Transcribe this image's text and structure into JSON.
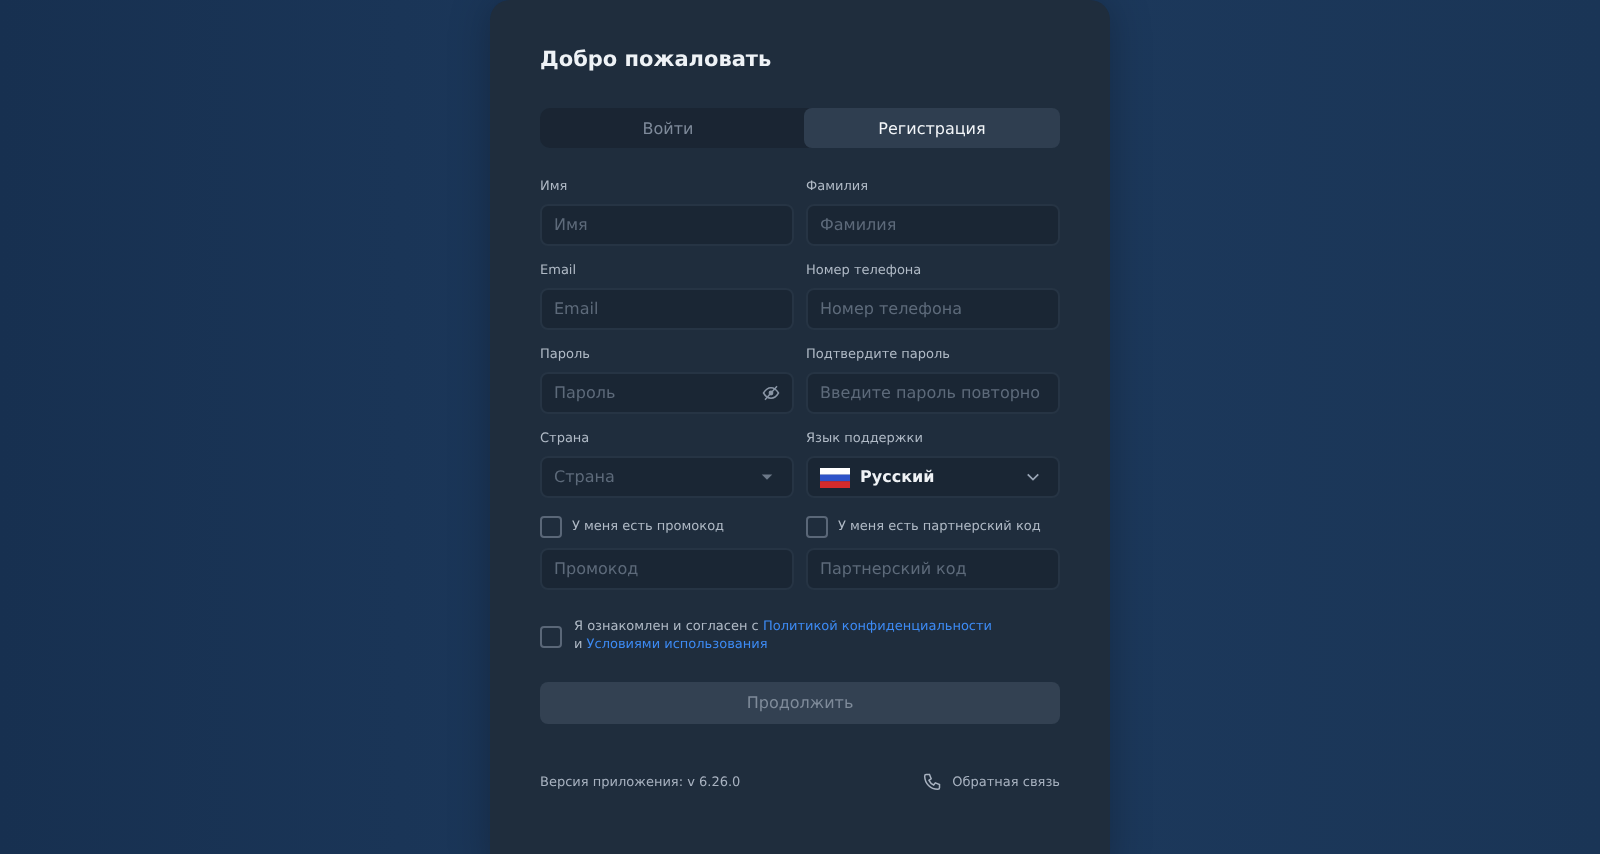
{
  "title": "Добро пожаловать",
  "tabs": [
    {
      "label": "Войти",
      "selected": false
    },
    {
      "label": "Регистрация",
      "selected": true
    }
  ],
  "fields": [
    {
      "kind": "text",
      "label": "Имя",
      "placeholder": "Имя"
    },
    {
      "kind": "text",
      "label": "Фамилия",
      "placeholder": "Фамилия"
    },
    {
      "kind": "text",
      "label": "Email",
      "placeholder": "Email"
    },
    {
      "kind": "text",
      "label": "Номер телефона",
      "placeholder": "Номер телефона"
    },
    {
      "kind": "password",
      "label": "Пароль",
      "placeholder": "Пароль"
    },
    {
      "kind": "text",
      "label": "Подтвердите пароль",
      "placeholder": "Введите пароль повторно"
    },
    {
      "kind": "select",
      "label": "Страна",
      "placeholder": "Страна"
    },
    {
      "kind": "language",
      "label": "Язык поддержки",
      "value": "Русский"
    }
  ],
  "codes": [
    {
      "label": "У меня есть промокод",
      "checked": false,
      "placeholder": "Промокод"
    },
    {
      "label": "У меня есть партнерский код",
      "checked": false,
      "placeholder": "Партнерский код"
    }
  ],
  "agreement": {
    "checked": false,
    "text": "Я ознакомлен и согласен с",
    "link_1": "Политикой конфиденциальности",
    "joiner": "и",
    "link_2": "Условиями использования"
  },
  "submit": {
    "label": "Продолжить",
    "disabled": true
  },
  "version": "Версия приложения: v 6.26.0",
  "feedback": "Обратная связь"
}
